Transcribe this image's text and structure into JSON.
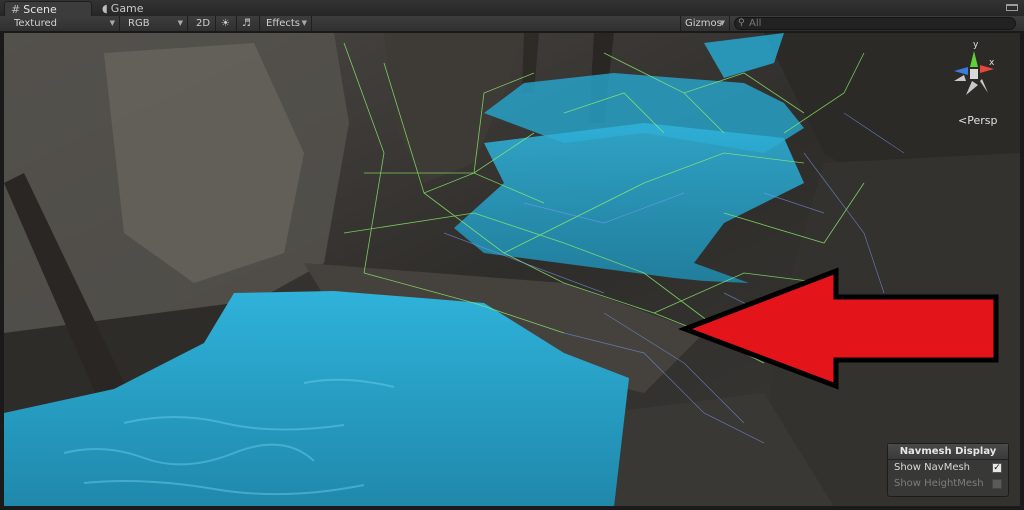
{
  "tabs": [
    {
      "label": "Scene",
      "icon": "grid-icon",
      "active": true
    },
    {
      "label": "Game",
      "icon": "pacman-icon",
      "active": false
    }
  ],
  "toolbar": {
    "draw_mode": "Textured",
    "render_mode": "RGB",
    "toggle_2d": "2D",
    "effects": "Effects",
    "gizmos": "Gizmos",
    "search_placeholder": "All"
  },
  "gizmo": {
    "projection_label": "Persp",
    "axes": [
      "y",
      "x"
    ]
  },
  "navmesh_panel": {
    "title": "Navmesh Display",
    "show_navmesh_label": "Show NavMesh",
    "show_navmesh_checked": true,
    "show_heightmesh_label": "Show HeightMesh",
    "show_heightmesh_checked": false
  },
  "colors": {
    "navmesh_fill": "#27a7cf",
    "arrow_red": "#e3151b",
    "wire_green": "#8cf06a",
    "wire_blue": "#7fa0ff",
    "axis_y": "#5fd03a",
    "axis_x": "#e8453b",
    "axis_z": "#3a7be0"
  }
}
